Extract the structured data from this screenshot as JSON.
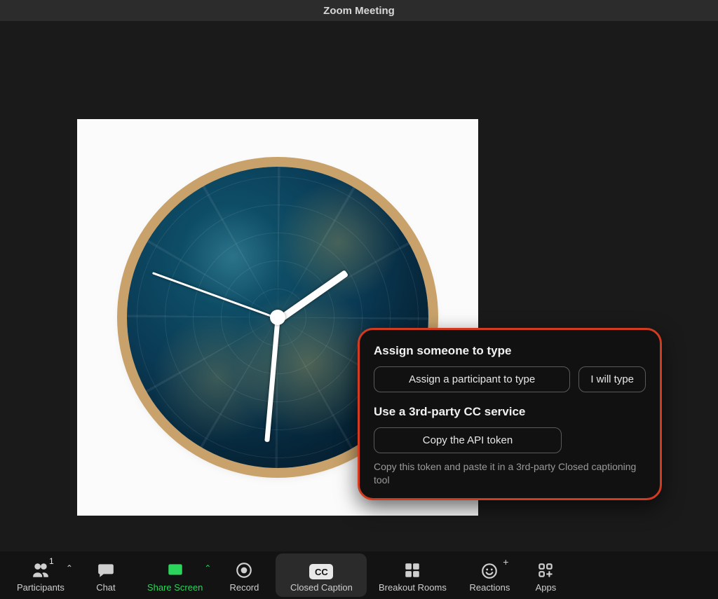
{
  "titlebar": {
    "title": "Zoom Meeting"
  },
  "popup": {
    "heading_assign": "Assign someone to type",
    "btn_assign": "Assign a participant to type",
    "btn_i_will": "I will type",
    "heading_service": "Use a 3rd-party CC service",
    "btn_copy": "Copy the API token",
    "helper": "Copy this token and paste it in a 3rd-party Closed captioning tool"
  },
  "toolbar": {
    "participants": {
      "label": "Participants",
      "count": "1"
    },
    "chat": {
      "label": "Chat"
    },
    "share": {
      "label": "Share Screen"
    },
    "record": {
      "label": "Record"
    },
    "cc": {
      "label": "Closed Caption",
      "badge": "CC"
    },
    "breakout": {
      "label": "Breakout Rooms"
    },
    "reactions": {
      "label": "Reactions"
    },
    "apps": {
      "label": "Apps"
    }
  }
}
